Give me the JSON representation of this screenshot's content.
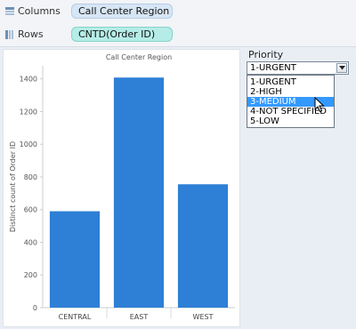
{
  "shelves": {
    "columns": {
      "label": "Columns",
      "pill": "Call Center Region"
    },
    "rows": {
      "label": "Rows",
      "pill": "CNTD(Order ID)"
    }
  },
  "chart_data": {
    "type": "bar",
    "title": "Call Center Region",
    "xlabel": "",
    "ylabel": "Distinct count of Order ID",
    "categories": [
      "CENTRAL",
      "EAST",
      "WEST"
    ],
    "values": [
      590,
      1408,
      755
    ],
    "ylim": [
      0,
      1480
    ],
    "yticks": [
      0,
      200,
      400,
      600,
      800,
      1000,
      1200,
      1400
    ],
    "grid": false,
    "bar_color": "#2e7fd6"
  },
  "filter": {
    "title": "Priority",
    "selected_value": "1-URGENT",
    "options": [
      "1-URGENT",
      "2-HIGH",
      "3-MEDIUM",
      "4-NOT SPECIFIED",
      "5-LOW"
    ],
    "highlighted_option": "3-MEDIUM"
  },
  "colors": {
    "accent": "#3399ff",
    "dimension_pill": "#d7e6f4",
    "measure_pill": "#b5ece7"
  },
  "icons": {
    "columns": "columns-icon",
    "rows": "rows-icon",
    "dropdown_arrow": "chevron-down-icon",
    "cursor": "mouse-pointer-icon"
  }
}
